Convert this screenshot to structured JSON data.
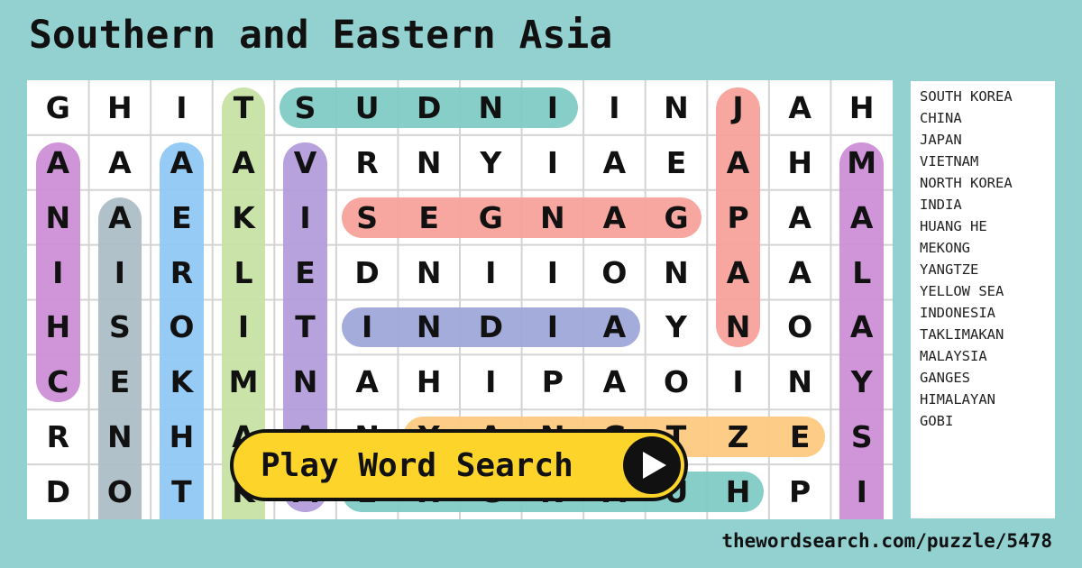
{
  "title": "Southern and Eastern Asia",
  "grid": {
    "rows": [
      "GHITSUDNIINJAH",
      "AAAAVRNYIAEAHM",
      "NAEKISEGNAGPAA",
      "IIRLEDNIIONAAL",
      "HSOITINDIAYNOA",
      "CEKMNAHIPAOINY",
      "RNHAANYANGTZES",
      "DOTKMEHGNAUHPI"
    ],
    "highlights": [
      {
        "word": "INDUS",
        "dir": "h",
        "row": 0,
        "from": 4,
        "to": 8,
        "color": "#7fcbc4"
      },
      {
        "word": "CHINA",
        "dir": "v",
        "col": 0,
        "from": 1,
        "to": 5,
        "color": "#cc8fd6"
      },
      {
        "word": "INDONESIA",
        "dir": "v",
        "col": 1,
        "from": 2,
        "to": 7,
        "color": "#adbec7",
        "open_end": true
      },
      {
        "word": "SOUTH KOREA",
        "dir": "v",
        "col": 2,
        "from": 1,
        "to": 7,
        "color": "#90c8f5",
        "open_end": true
      },
      {
        "word": "TAKLIMAKAN",
        "dir": "v",
        "col": 3,
        "from": 0,
        "to": 7,
        "color": "#c6e2a4",
        "open_end": true
      },
      {
        "word": "VIETNAM",
        "dir": "v",
        "col": 4,
        "from": 1,
        "to": 7,
        "color": "#b39ddc"
      },
      {
        "word": "GANGES",
        "dir": "h",
        "row": 2,
        "from": 5,
        "to": 10,
        "color": "#f8a19b"
      },
      {
        "word": "JAPAN",
        "dir": "v",
        "col": 11,
        "from": 0,
        "to": 4,
        "color": "#f8a19b"
      },
      {
        "word": "INDIA",
        "dir": "h",
        "row": 4,
        "from": 5,
        "to": 9,
        "color": "#9fa8da"
      },
      {
        "word": "YANGTZE",
        "dir": "h",
        "row": 6,
        "from": 6,
        "to": 12,
        "color": "#fdca82"
      },
      {
        "word": "HUANG HE",
        "dir": "h",
        "row": 7,
        "from": 5,
        "to": 11,
        "color": "#7fcbc4"
      },
      {
        "word": "MALAYSIA",
        "dir": "v",
        "col": 13,
        "from": 1,
        "to": 7,
        "color": "#cc8fd6",
        "open_end": true
      }
    ]
  },
  "words": [
    "SOUTH KOREA",
    "CHINA",
    "JAPAN",
    "VIETNAM",
    "NORTH KOREA",
    "INDIA",
    "HUANG HE",
    "MEKONG",
    "YANGTZE",
    "YELLOW SEA",
    "INDONESIA",
    "TAKLIMAKAN",
    "MALAYSIA",
    "GANGES",
    "HIMALAYAN",
    "GOBI"
  ],
  "play_button": {
    "label": "Play Word Search",
    "icon": "play-icon"
  },
  "url": "thewordsearch.com/puzzle/5478",
  "colors": {
    "background": "#93d1d1",
    "button": "#fdd42a"
  }
}
